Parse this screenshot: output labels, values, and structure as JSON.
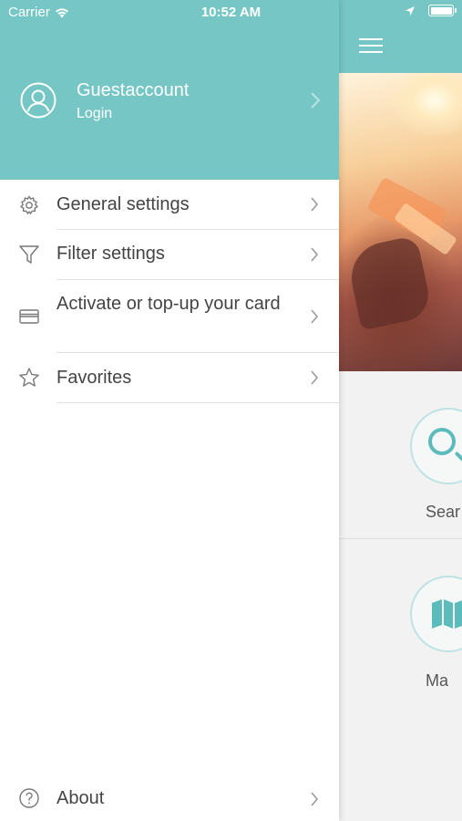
{
  "status_bar": {
    "carrier": "Carrier",
    "time": "10:52 AM"
  },
  "drawer": {
    "header": {
      "account_name": "Guestaccount",
      "login_label": "Login"
    },
    "items": [
      {
        "label": "General settings",
        "icon": "gear-icon"
      },
      {
        "label": "Filter settings",
        "icon": "filter-icon"
      },
      {
        "label": "Activate or top-up your card",
        "icon": "card-icon"
      },
      {
        "label": "Favorites",
        "icon": "star-icon"
      }
    ],
    "about": {
      "label": "About",
      "icon": "help-icon"
    }
  },
  "main": {
    "tiles": [
      {
        "label": "Sear",
        "icon": "search-icon"
      },
      {
        "label": "Ma",
        "icon": "map-icon"
      }
    ]
  },
  "colors": {
    "accent": "#76c6c6",
    "icon_teal": "#5cbcbc",
    "text": "#444444",
    "divider": "#e2e2e2"
  }
}
